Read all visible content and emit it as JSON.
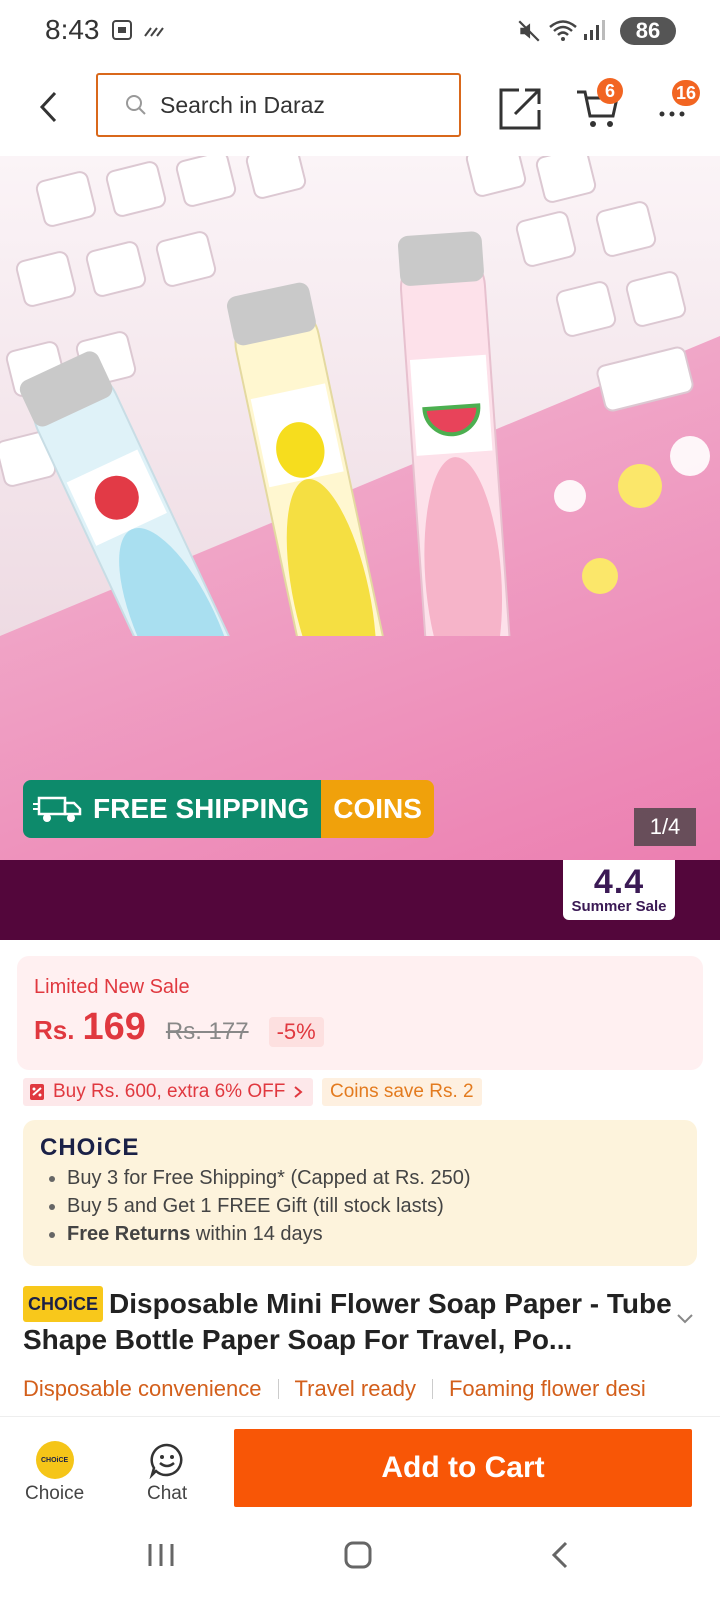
{
  "status_bar": {
    "time": "8:43",
    "battery": "86",
    "icons": [
      "screenshot-icon",
      "signal-dots-icon",
      "mute-icon",
      "wifi-icon",
      "cell-signal-icon",
      "battery-icon"
    ]
  },
  "header": {
    "search_placeholder": "Search in Daraz",
    "cart_count": "6",
    "more_count": "16",
    "accent_color": "#d9681b",
    "badge_color": "#f26522"
  },
  "gallery": {
    "free_shipping_label": "FREE SHIPPING",
    "free_badge": "FREE",
    "coins_label": "COINS",
    "image_counter": "1/4",
    "tube_labels": [
      "Strawberry",
      "Pear",
      "Watermelon"
    ]
  },
  "promo": {
    "badge_big": "4.4",
    "badge_small": "Summer Sale",
    "bg_color": "#53063b"
  },
  "price": {
    "sale_label": "Limited New Sale",
    "currency": "Rs.",
    "current": "169",
    "original": "Rs. 177",
    "discount": "-5%",
    "accent_color": "#e0383f"
  },
  "tags": {
    "voucher": "Buy Rs. 600, extra 6% OFF",
    "coins": "Coins save Rs. 2"
  },
  "choice": {
    "logo_big": "C",
    "logo_rest": "HOiCE",
    "benefits": [
      "Buy 3 for  Free Shipping* (Capped at Rs. 250)",
      "Buy 5 and Get 1 FREE Gift (till stock lasts)"
    ],
    "returns_bold": "Free Returns",
    "returns_rest": " within 14 days"
  },
  "product": {
    "choice_tag": "CHOiCE",
    "title": "Disposable Mini Flower Soap Paper - Tube Shape Bottle Paper Soap For Travel, Po...",
    "highlights": [
      "Disposable convenience",
      "Travel ready",
      "Foaming flower desi"
    ]
  },
  "bottom_bar": {
    "choice_label": "Choice",
    "choice_icon_text": "CHOiCE",
    "chat_label": "Chat",
    "add_to_cart": "Add to Cart",
    "cta_color": "#f85606"
  }
}
